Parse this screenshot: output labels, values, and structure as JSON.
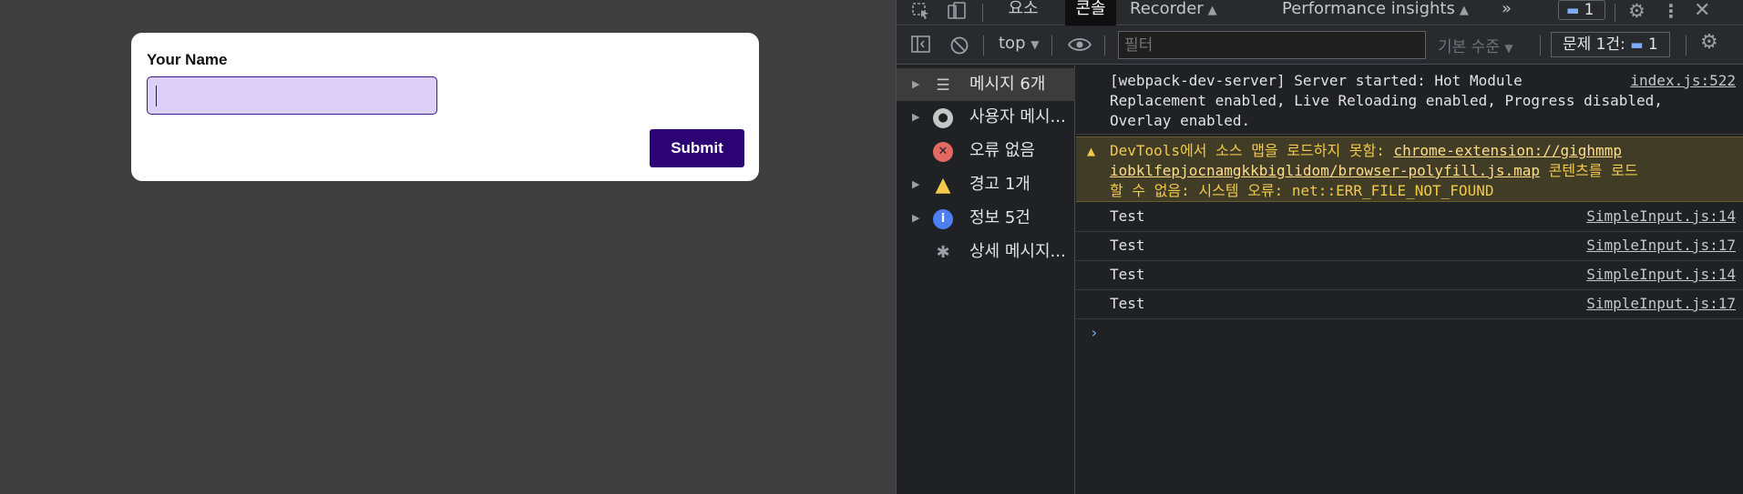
{
  "form": {
    "label": "Your Name",
    "input_value": "",
    "submit_label": "Submit"
  },
  "devtools": {
    "tabs": [
      {
        "label": "요소"
      },
      {
        "label": "콘솔"
      },
      {
        "label": "Recorder"
      },
      {
        "label": "Performance insights"
      }
    ],
    "more_tabs": "»",
    "issues_badge_count": "1",
    "toolbar": {
      "context": "top",
      "filter_placeholder": "필터",
      "levels": "기본 수준",
      "issues_counter": "문제 1건:",
      "issues_counter_count": "1"
    },
    "sidebar": {
      "items": [
        {
          "label": "메시지 6개",
          "icon": "list-icon"
        },
        {
          "label": "사용자 메시...",
          "icon": "user-icon"
        },
        {
          "label": "오류 없음",
          "icon": "error-icon"
        },
        {
          "label": "경고 1개",
          "icon": "warning-icon"
        },
        {
          "label": "정보 5건",
          "icon": "info-icon"
        },
        {
          "label": "상세 메시지...",
          "icon": "bug-icon"
        }
      ]
    },
    "messages": [
      {
        "text": "[webpack-dev-server] Server started: Hot Module\nReplacement enabled, Live Reloading enabled, Progress disabled,\nOverlay enabled.",
        "source": "index.js:522"
      },
      {
        "warn_prefix": "DevTools에서 소스 맵을 로드하지 못함: ",
        "warn_link": "chrome-extension://gighmmp\niobklfepjocnamgkkbiglidom/browser-polyfill.js.map",
        "warn_suffix": " 콘텐츠를 로드\n할 수 없음: 시스템 오류: net::ERR_FILE_NOT_FOUND"
      },
      {
        "text": "Test",
        "source": "SimpleInput.js:14"
      },
      {
        "text": "Test",
        "source": "SimpleInput.js:17"
      },
      {
        "text": "Test",
        "source": "SimpleInput.js:14"
      },
      {
        "text": "Test",
        "source": "SimpleInput.js:17"
      }
    ],
    "colors": {
      "accent": "#7cacf8",
      "warning": "#f2c94c",
      "error": "#e46962",
      "submit_bg": "#2b0372",
      "input_bg": "#dccff8"
    }
  }
}
